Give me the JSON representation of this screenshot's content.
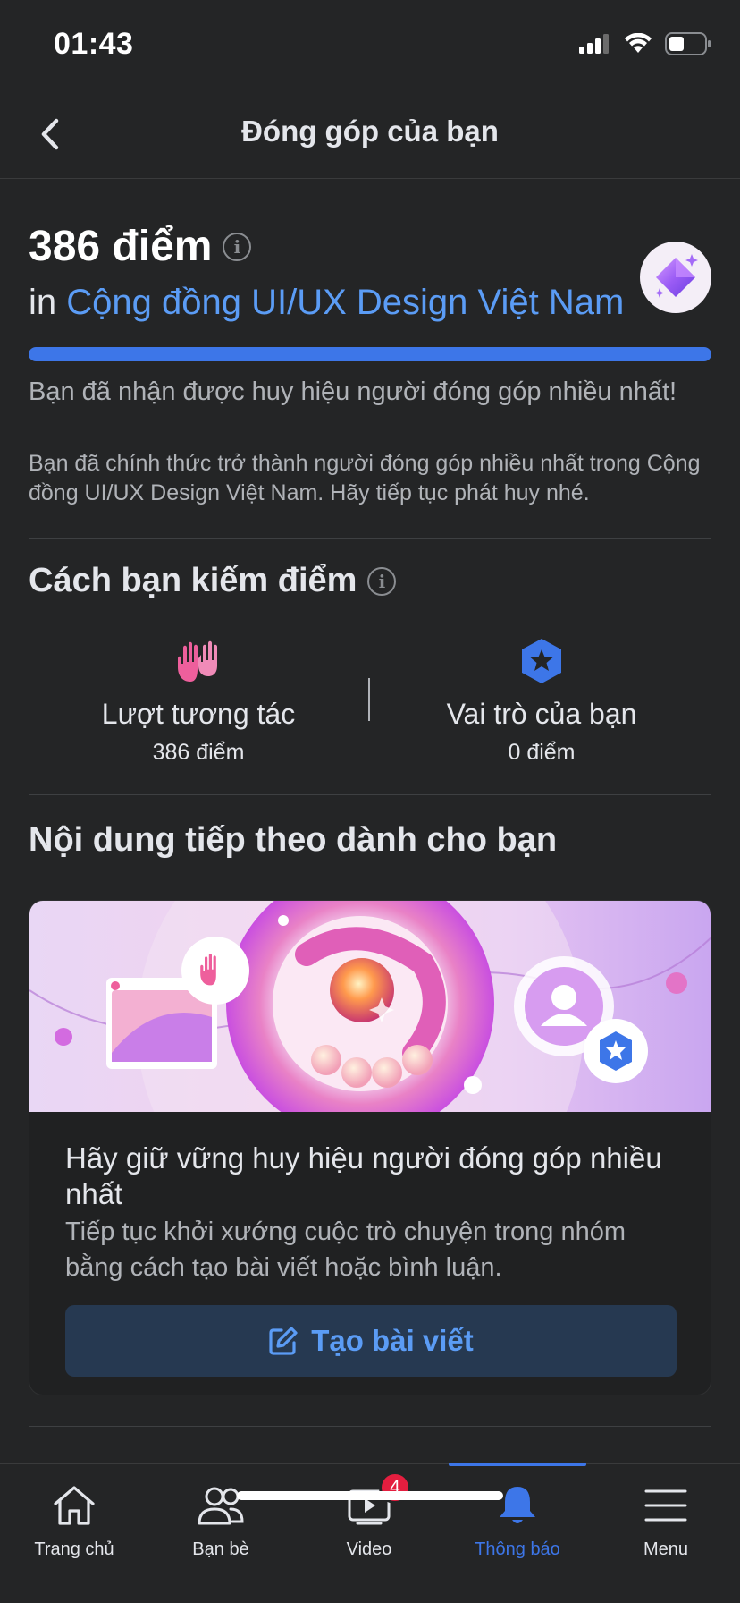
{
  "status_bar": {
    "time": "01:43"
  },
  "nav": {
    "title": "Đóng góp của bạn"
  },
  "summary": {
    "points": "386 điểm",
    "in_prefix": "in",
    "group_name": "Cộng đồng UI/UX Design Việt Nam",
    "progress": 1.0,
    "badge_title": "Bạn đã nhận được huy hiệu người đóng góp nhiều nhất!",
    "badge_desc": "Bạn đã chính thức trở thành người đóng góp nhiều nhất trong Cộng đồng UI/UX Design Việt Nam. Hãy tiếp tục phát huy nhé."
  },
  "earn": {
    "heading": "Cách bạn kiếm điểm",
    "items": [
      {
        "label": "Lượt tương tác",
        "value": "386 điểm",
        "icon": "waving-hands-icon"
      },
      {
        "label": "Vai trò của bạn",
        "value": "0 điểm",
        "icon": "star-shield-icon"
      }
    ]
  },
  "next": {
    "heading": "Nội dung tiếp theo dành cho bạn",
    "card_title": "Hãy giữ vững huy hiệu người đóng góp nhiều nhất",
    "card_desc": "Tiếp tục khởi xướng cuộc trò chuyện trong nhóm bằng cách tạo bài viết hoặc bình luận.",
    "button_label": "Tạo bài viết"
  },
  "tabs": [
    {
      "label": "Trang chủ",
      "icon": "home-icon"
    },
    {
      "label": "Bạn bè",
      "icon": "friends-icon"
    },
    {
      "label": "Video",
      "icon": "video-icon",
      "badge": "4"
    },
    {
      "label": "Thông báo",
      "icon": "bell-icon",
      "active": true
    },
    {
      "label": "Menu",
      "icon": "menu-icon"
    }
  ],
  "colors": {
    "accent": "#3d76e8",
    "link": "#5b9cf5",
    "background": "#242526"
  }
}
